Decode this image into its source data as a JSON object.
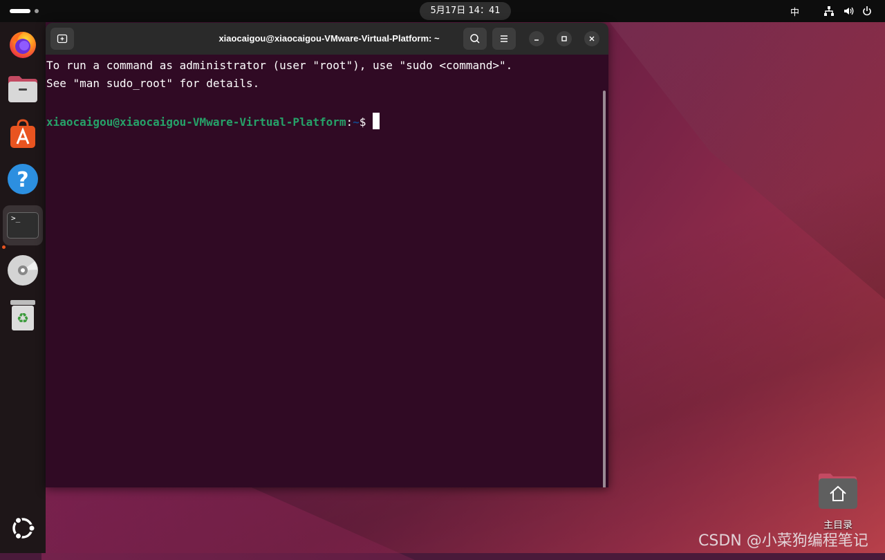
{
  "topbar": {
    "clock": "5月17日  14：41",
    "input_method": "中",
    "icons": [
      "network-icon",
      "volume-icon",
      "power-icon"
    ]
  },
  "dock": {
    "items": [
      {
        "name": "firefox",
        "icon": "firefox-icon"
      },
      {
        "name": "files",
        "icon": "files-icon"
      },
      {
        "name": "app-center",
        "icon": "app-center-icon"
      },
      {
        "name": "help",
        "icon": "help-icon"
      },
      {
        "name": "terminal",
        "icon": "terminal-icon",
        "active": true
      },
      {
        "name": "dvd",
        "icon": "dvd-icon"
      },
      {
        "name": "trash",
        "icon": "trash-icon"
      },
      {
        "name": "show-apps",
        "icon": "ubuntu-logo-icon"
      }
    ],
    "terminal_glyph": ">_",
    "help_glyph": "?",
    "trash_glyph": "♻"
  },
  "terminal": {
    "title": "xiaocaigou@xiaocaigou-VMware-Virtual-Platform: ~",
    "lines": [
      "To run a command as administrator (user \"root\"), use \"sudo <command>\".",
      "See \"man sudo_root\" for details."
    ],
    "prompt_user": "xiaocaigou@xiaocaigou-VMware-Virtual-Platform",
    "prompt_colon": ":",
    "prompt_path": "~",
    "prompt_symbol": "$ ",
    "colors": {
      "background": "#300a24",
      "prompt_user": "#26a269",
      "prompt_path": "#12488b"
    }
  },
  "desktop": {
    "home_label": "主目录"
  },
  "watermark": "CSDN @小菜狗编程笔记"
}
